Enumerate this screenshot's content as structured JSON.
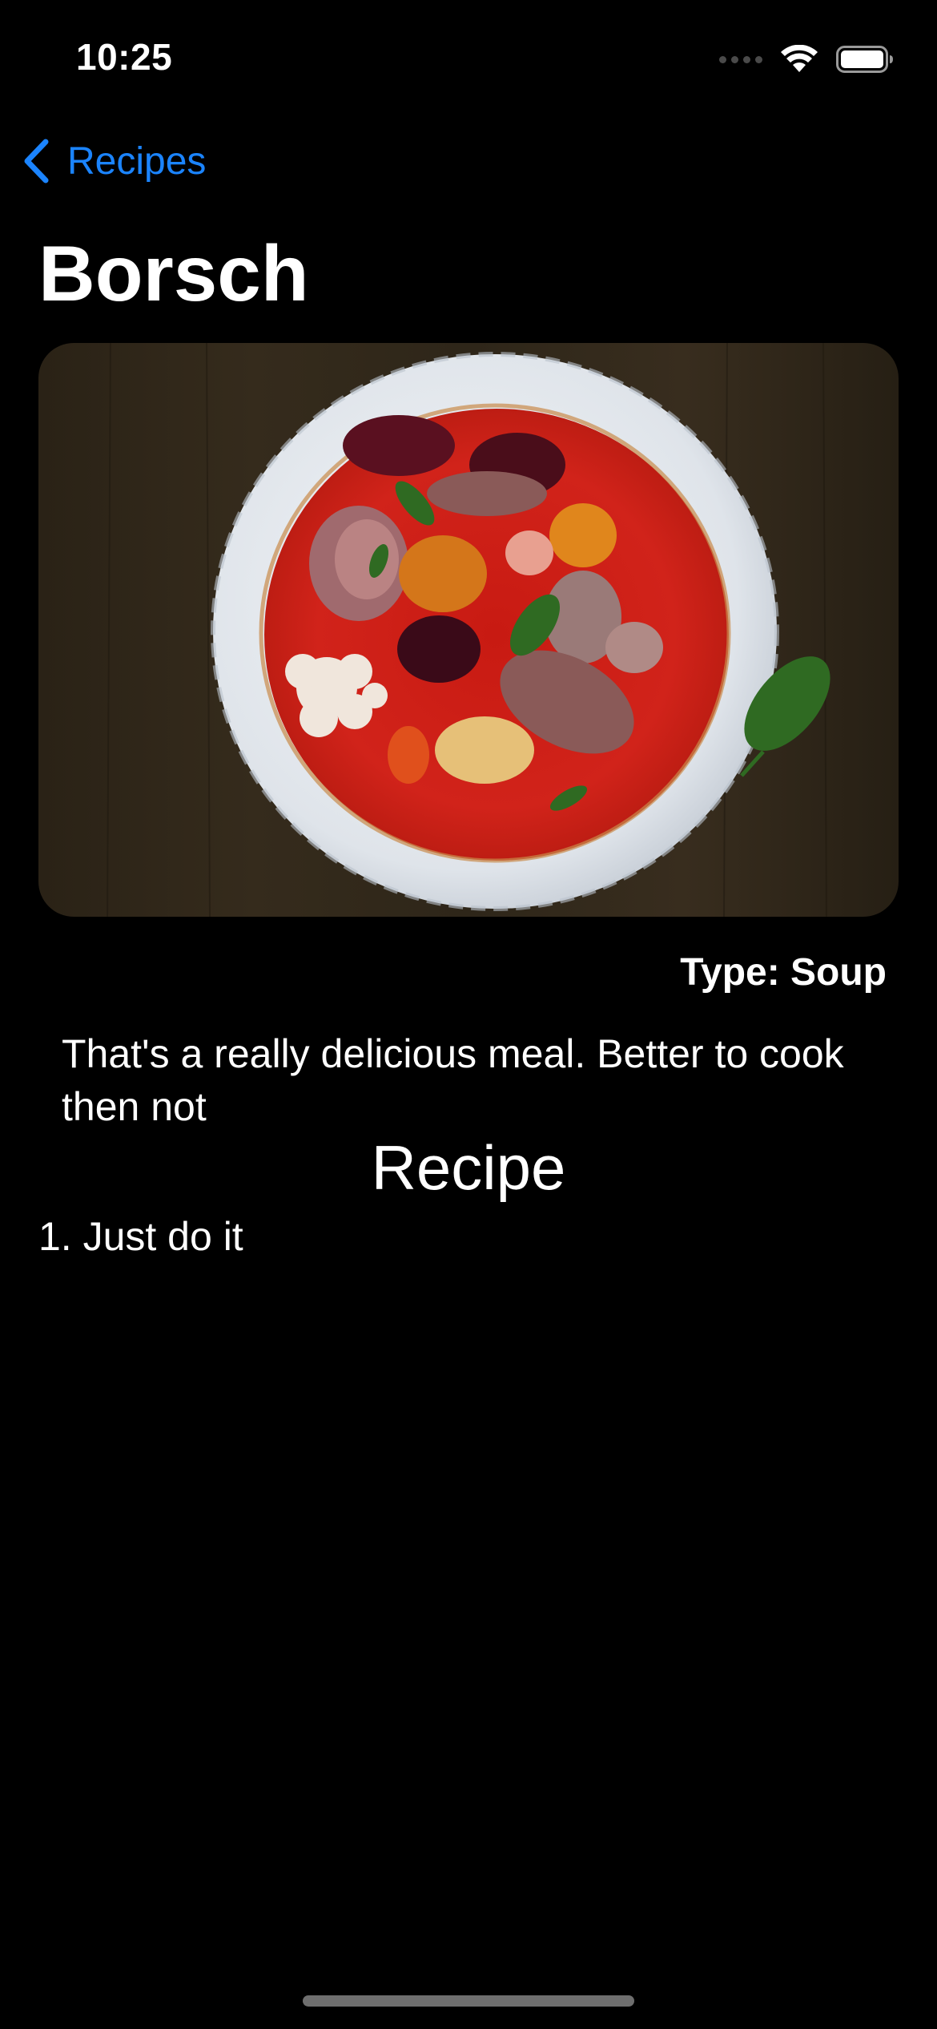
{
  "status_bar": {
    "time": "10:25",
    "icons": [
      "cellular-signal-icon",
      "wifi-icon",
      "battery-icon"
    ]
  },
  "nav": {
    "back_label": "Recipes",
    "back_icon": "chevron-left-icon"
  },
  "recipe": {
    "title": "Borsch",
    "image_icon": "borsch-photo",
    "type_text": "Type: Soup",
    "description": "That's a really delicious meal. Better to cook then not",
    "section_heading": "Recipe",
    "steps": [
      "1. Just do it"
    ]
  },
  "colors": {
    "background": "#000000",
    "accent": "#1b84ff",
    "text": "#ffffff"
  }
}
